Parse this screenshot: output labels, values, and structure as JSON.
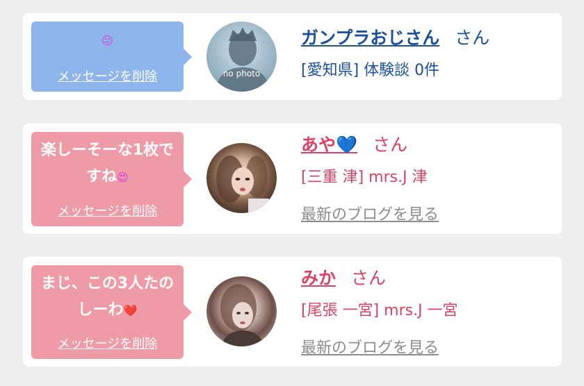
{
  "messages": [
    {
      "bubble_text": "",
      "bubble_emoji": "😐",
      "delete_label": "メッセージを削除",
      "name": "ガンプラおじさん",
      "honorific": "さん",
      "location": "[愛知県]",
      "detail": "体験談 0件",
      "avatar_caption": "no photo",
      "bubble_color": "#8eb4ec",
      "text_color": "#1c4f9a"
    },
    {
      "bubble_text": "楽しーそーな1枚ですね",
      "bubble_emoji": "😍",
      "delete_label": "メッセージを削除",
      "name": "あや",
      "name_emoji": "💙",
      "honorific": "さん",
      "location": "[三重 津]",
      "detail": "mrs.J 津",
      "blog_link": "最新のブログを見る",
      "bubble_color": "#ef9aa7",
      "text_color": "#d94262"
    },
    {
      "bubble_text": "まじ、この3人たのしーわ",
      "bubble_emoji": "❤️",
      "delete_label": "メッセージを削除",
      "name": "みか",
      "honorific": "さん",
      "location": "[尾張 一宮]",
      "detail": "mrs.J 一宮",
      "blog_link": "最新のブログを見る",
      "bubble_color": "#ef9aa7",
      "text_color": "#d94262"
    }
  ]
}
